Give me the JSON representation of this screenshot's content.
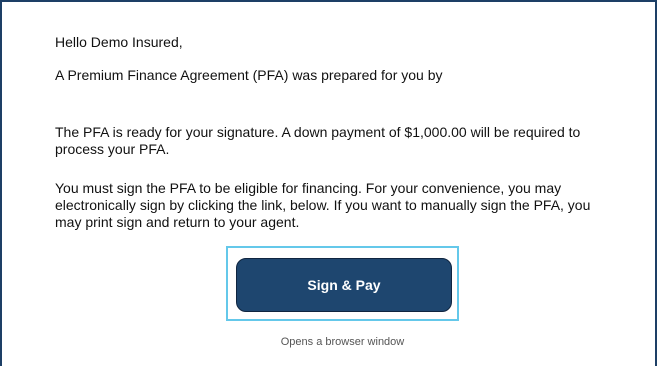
{
  "email": {
    "greeting": "Hello Demo Insured,",
    "intro": "A Premium Finance Agreement (PFA) was prepared for you by",
    "ready_notice": "The PFA is ready for your signature. A down payment of $1,000.00 will be required to process your PFA.",
    "sign_instructions": "You must sign the PFA to be eligible for financing. For your convenience, you may electronically sign by clicking the link, below. If you want to manually sign the PFA, you may print sign and return to your agent."
  },
  "action": {
    "button_label": "Sign & Pay",
    "hint": "Opens a browser window"
  },
  "colors": {
    "frame_border": "#1d3f66",
    "button_bg": "#1e466f",
    "focus_ring": "#64c8ea"
  }
}
